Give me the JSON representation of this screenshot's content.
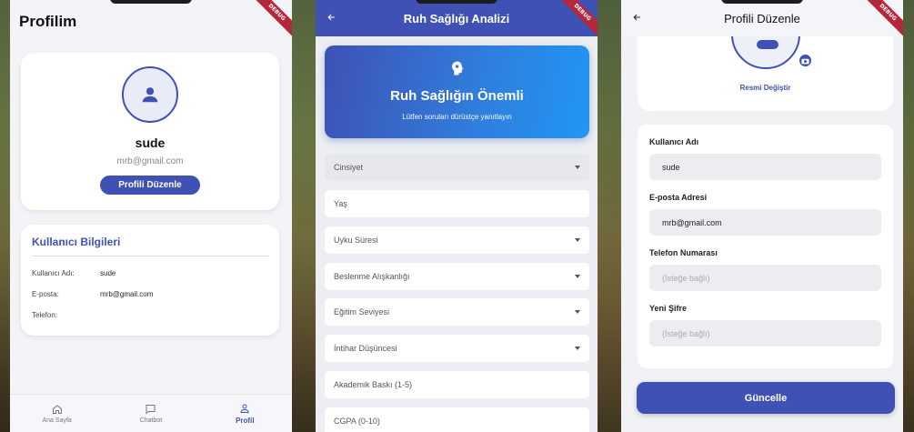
{
  "debug_label": "DEBUG",
  "colors": {
    "primary": "#3f51b5",
    "gradient_end": "#2196f3",
    "debug": "#b5283b"
  },
  "profile_screen": {
    "title": "Profilim",
    "name": "sude",
    "email": "mrb@gmail.com",
    "edit_button": "Profili Düzenle",
    "info_title": "Kullanıcı Bilgileri",
    "rows": [
      {
        "key": "Kullanıcı Adı:",
        "value": "sude"
      },
      {
        "key": "E-posta:",
        "value": "mrb@gmail.com"
      },
      {
        "key": "Telefon:",
        "value": ""
      }
    ],
    "nav": [
      {
        "label": "Ana Sayfa",
        "icon": "home-icon"
      },
      {
        "label": "Chatbot",
        "icon": "chat-icon"
      },
      {
        "label": "Profil",
        "icon": "person-icon",
        "active": true
      }
    ]
  },
  "analysis_screen": {
    "title": "Ruh Sağlığı Analizi",
    "hero_title": "Ruh Sağlığın Önemli",
    "hero_subtitle": "Lütfen soruları dürüstçe yanıtlayın",
    "fields": [
      {
        "label": "Cinsiyet",
        "dropdown": true
      },
      {
        "label": "Yaş",
        "dropdown": false
      },
      {
        "label": "Uyku Süresi",
        "dropdown": true
      },
      {
        "label": "Beslenme Alışkanlığı",
        "dropdown": true
      },
      {
        "label": "Eğitim Seviyesi",
        "dropdown": true
      },
      {
        "label": "İntihar Düşüncesi",
        "dropdown": true
      },
      {
        "label": "Akademik Baskı (1-5)",
        "dropdown": false
      },
      {
        "label": "CGPA (0-10)",
        "dropdown": false
      }
    ]
  },
  "edit_screen": {
    "title": "Profili Düzenle",
    "change_picture": "Resmi Değiştir",
    "fields": [
      {
        "label": "Kullanıcı Adı",
        "value": "sude",
        "placeholder": ""
      },
      {
        "label": "E-posta Adresi",
        "value": "mrb@gmail.com",
        "placeholder": ""
      },
      {
        "label": "Telefon Numarası",
        "value": "",
        "placeholder": "(İsteğe bağlı)"
      },
      {
        "label": "Yeni Şifre",
        "value": "",
        "placeholder": "(İsteğe bağlı)"
      }
    ],
    "update_button": "Güncelle"
  }
}
